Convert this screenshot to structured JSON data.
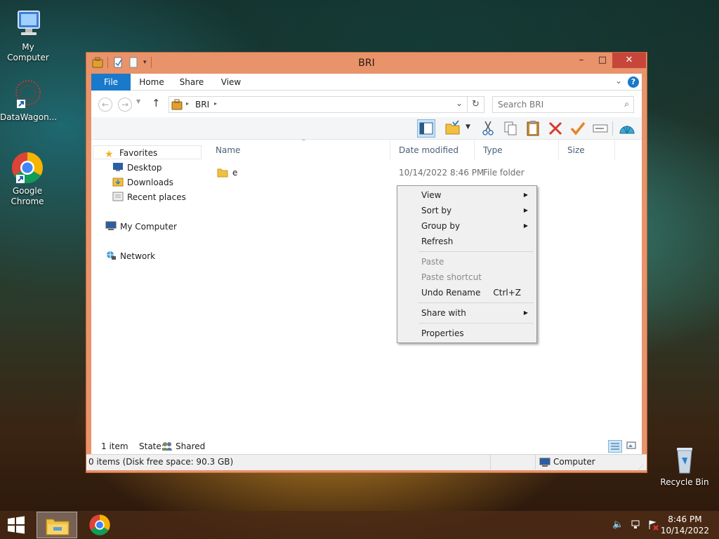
{
  "desktop": {
    "icons": [
      {
        "label": "My Computer"
      },
      {
        "label": "DataWagon..."
      },
      {
        "label": "Google Chrome"
      },
      {
        "label": "Recycle Bin"
      }
    ]
  },
  "window": {
    "title": "BRI",
    "controls": {
      "minimize": "–",
      "maximize": "□",
      "close": "✕"
    },
    "tabs": [
      {
        "label": "File"
      },
      {
        "label": "Home"
      },
      {
        "label": "Share"
      },
      {
        "label": "View"
      }
    ],
    "help": "?",
    "address": {
      "crumb": "BRI"
    },
    "search": {
      "placeholder": "Search BRI"
    },
    "nav": {
      "favorites": "Favorites",
      "desktop": "Desktop",
      "downloads": "Downloads",
      "recent": "Recent places",
      "computer": "My Computer",
      "network": "Network"
    },
    "columns": {
      "name": "Name",
      "date": "Date modified",
      "type": "Type",
      "size": "Size"
    },
    "rows": [
      {
        "name": "e",
        "date": "10/14/2022 8:46 PM",
        "type": "File folder",
        "size": ""
      }
    ],
    "status": {
      "items": "1 item",
      "state_label": "State:",
      "state_value": "Shared",
      "disk": "0 items (Disk free space: 90.3 GB)",
      "location": "Computer"
    }
  },
  "context_menu": {
    "view": "View",
    "sort_by": "Sort by",
    "group_by": "Group by",
    "refresh": "Refresh",
    "paste": "Paste",
    "paste_shortcut": "Paste shortcut",
    "undo_rename": "Undo Rename",
    "undo_shortcut": "Ctrl+Z",
    "share_with": "Share with",
    "properties": "Properties"
  },
  "taskbar": {
    "time": "8:46 PM",
    "date": "10/14/2022"
  },
  "colors": {
    "window_frame": "#e8936a",
    "file_tab": "#1979ca",
    "close_button": "#c7463a"
  }
}
